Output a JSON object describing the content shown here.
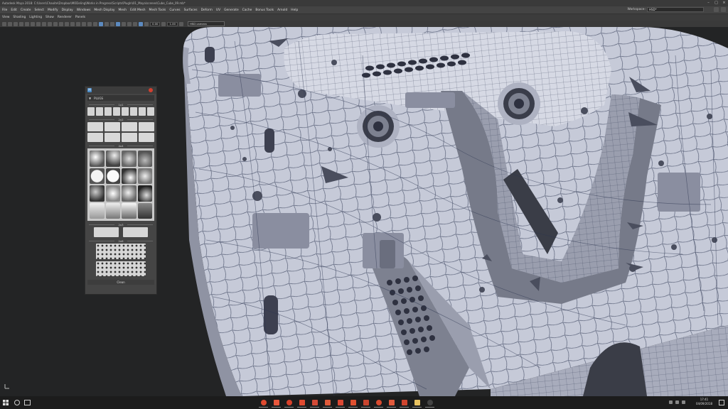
{
  "window": {
    "title": "Autodesk Maya 2018: C:\\Users\\Chaoite\\Dropbox\\MODeling\\Works in Progress\\Scripts\\PlugIn\\01_Maya\\scenes\\Cube_Cube_09.mb*"
  },
  "menubar": {
    "items": [
      "File",
      "Edit",
      "Create",
      "Select",
      "Modify",
      "Display",
      "Windows",
      "Mesh Display",
      "Mesh",
      "Edit Mesh",
      "Mesh Tools",
      "Curves",
      "Surfaces",
      "Deform",
      "UV",
      "Generate",
      "Cache",
      "Bonus Tools",
      "Arnold",
      "Help"
    ],
    "workspace_label": "Workspace:",
    "workspace_value": "HSD*"
  },
  "viewport_menu": {
    "items": [
      "View",
      "Shading",
      "Lighting",
      "Show",
      "Renderer",
      "Panels"
    ]
  },
  "viewport_toolbar": {
    "field1": "0.00",
    "field2": "1.00",
    "camera": "HSD camera"
  },
  "tool_panel": {
    "title": "",
    "dropdown_label": "PLUGS",
    "sections": [
      "1x1",
      "2x2",
      "4x4",
      "2x3",
      "2x6"
    ],
    "clean_button": "Clean"
  },
  "taskbar": {
    "time": "17:41",
    "date": "04/09/2018"
  },
  "colors": {
    "viewport_bg": "#232425",
    "model_fill": "#c6cad8",
    "wireframe": "#2c3550",
    "accent_blue": "#5c8ac0",
    "maya_red": "#d04030"
  },
  "icons": {
    "start": "windows-logo-icon",
    "taskbar_apps": [
      "chrome-icon",
      "folder-icon",
      "opera-icon",
      "maya-icon",
      "maya-icon",
      "substance-icon",
      "marmoset-icon",
      "app-icon",
      "app-icon",
      "obs-icon",
      "app-icon",
      "photoshop-icon",
      "files-icon",
      "app-icon"
    ]
  }
}
